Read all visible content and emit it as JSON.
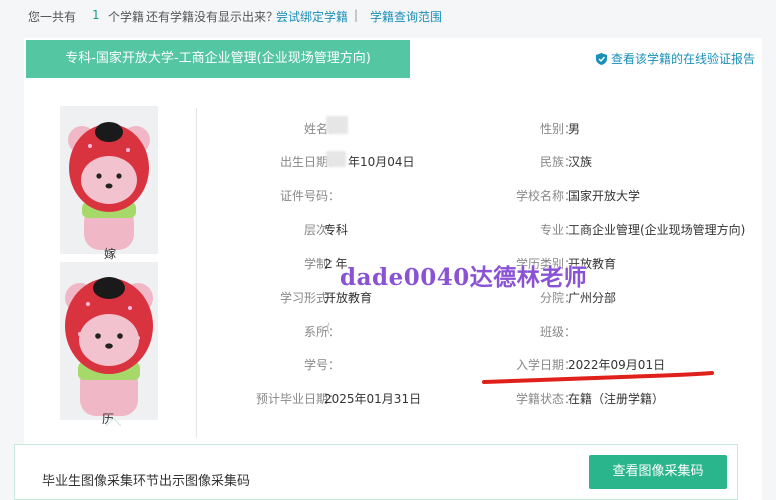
{
  "topbar": {
    "summary_prefix": "您一共有",
    "count": "1",
    "summary_suffix": "个学籍",
    "question": "还有学籍没有显示出来？",
    "bind_link": "尝试绑定学籍",
    "separator": "|",
    "scope_link": "学籍查询范围"
  },
  "record": {
    "banner_title": "专科-国家开放大学-工商企业管理(企业现场管理方向)",
    "verify_link": "查看该学籍的在线验证报告",
    "photo_captions": [
      "嫁",
      "历"
    ],
    "left_fields": [
      {
        "label": "姓名：",
        "value": ""
      },
      {
        "label": "出生日期：",
        "value": "年10月04日"
      },
      {
        "label": "证件号码：",
        "value": ""
      },
      {
        "label": "层次：",
        "value": "专科"
      },
      {
        "label": "学制：",
        "value": "2 年"
      },
      {
        "label": "学习形式：",
        "value": "开放教育"
      },
      {
        "label": "系所：",
        "value": "("
      },
      {
        "label": "学号：",
        "value": ""
      },
      {
        "label": "预计毕业日期：",
        "value": "2025年01月31日"
      }
    ],
    "right_fields": [
      {
        "label": "性别：",
        "value": "男"
      },
      {
        "label": "民族：",
        "value": "汉族"
      },
      {
        "label": "学校名称：",
        "value": "国家开放大学"
      },
      {
        "label": "专业：",
        "value": "工商企业管理(企业现场管理方向)"
      },
      {
        "label": "学历类别：",
        "value": "开放教育"
      },
      {
        "label": "分院：",
        "value": "广州分部"
      },
      {
        "label": "班级：",
        "value": ""
      },
      {
        "label": "入学日期：",
        "value": "2022年09月01日"
      },
      {
        "label": "学籍状态：",
        "value": "在籍（注册学籍）"
      }
    ]
  },
  "watermark_text": "dade0040达德林老师",
  "bottom": {
    "text": "毕业生图像采集环节出示图像采集码",
    "button": "查看图像采集码"
  },
  "colors": {
    "banner": "#55c6a2",
    "button": "#2bb58c",
    "link": "#1a8fb8",
    "underline": "#e0201a"
  }
}
